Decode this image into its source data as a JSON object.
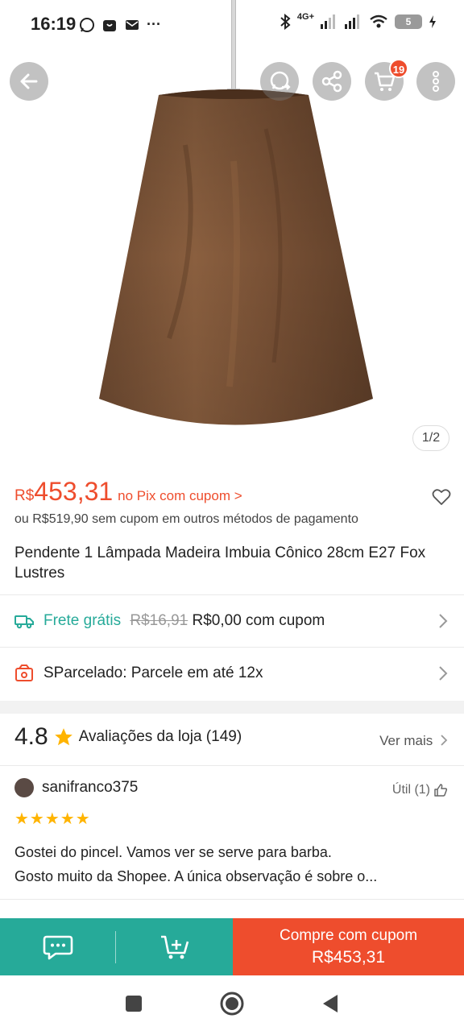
{
  "status_bar": {
    "time": "16:19",
    "network": "4G+",
    "battery": "5"
  },
  "gallery": {
    "counter": "1/2",
    "cart_count": "19"
  },
  "price": {
    "currency": "R$",
    "value": "453,31",
    "note": "no Pix com cupom >",
    "alternative": "ou R$519,90 sem cupom em outros métodos de pagamento"
  },
  "product": {
    "title": "Pendente 1 Lâmpada Madeira Imbuia Cônico 28cm E27 Fox Lustres"
  },
  "shipping": {
    "label": "Frete grátis",
    "old_price": "R$16,91",
    "new_price": "R$0,00 com cupom"
  },
  "installments": {
    "label": "SParcelado: Parcele em até 12x"
  },
  "store_rating": {
    "score": "4.8",
    "label": "Avaliações da loja (149)",
    "see_more": "Ver mais"
  },
  "review": {
    "username": "sanifranco375",
    "helpful": "Útil (1)",
    "stars": "★★★★★",
    "line1": "Gostei do pincel. Vamos ver se serve para barba.",
    "line2": "Gosto muito da Shopee. A única observação é sobre o..."
  },
  "bottom_bar": {
    "buy_label": "Compre com cupom",
    "buy_price": "R$453,31"
  },
  "colors": {
    "brand_orange": "#ee4d2d",
    "teal": "#26aa99",
    "star": "#ffb400"
  }
}
